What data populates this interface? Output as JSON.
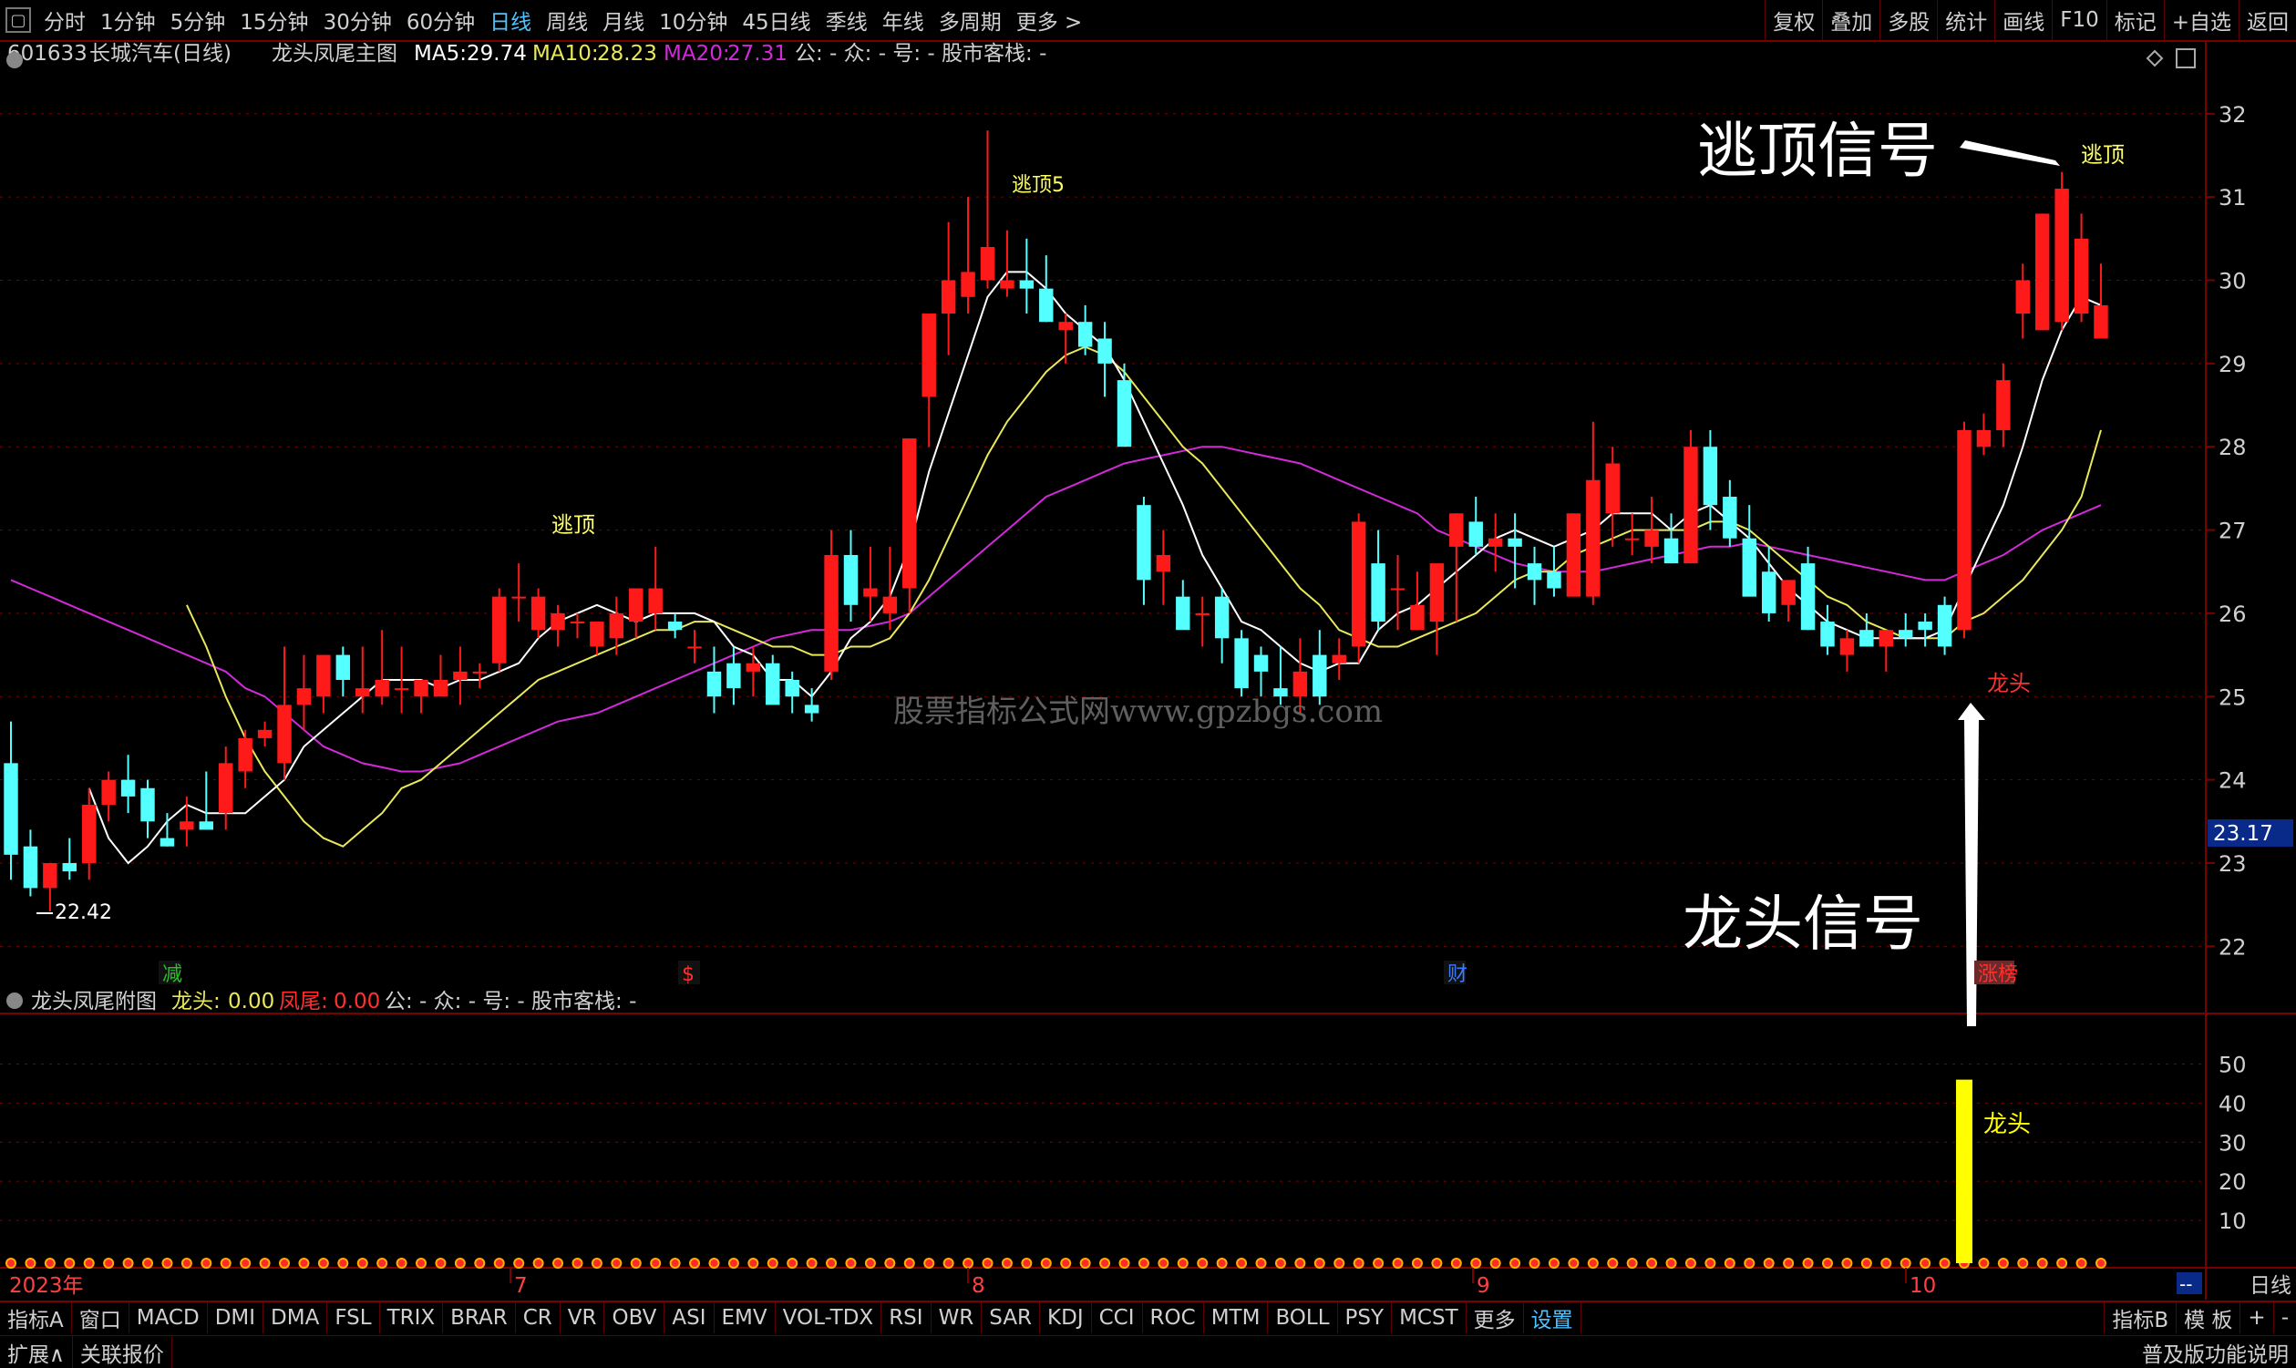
{
  "toolbar": {
    "icon": "window-menu-icon",
    "periods": [
      "分时",
      "1分钟",
      "5分钟",
      "15分钟",
      "30分钟",
      "60分钟",
      "日线",
      "周线",
      "月线",
      "10分钟",
      "45日线",
      "季线",
      "年线",
      "多周期",
      "更多 >"
    ],
    "active": "日线",
    "right": [
      "复权",
      "叠加",
      "多股",
      "统计",
      "画线",
      "F10",
      "标记",
      "+自选",
      "返回"
    ]
  },
  "main": {
    "code": "601633",
    "name": "长城汽车(日线)",
    "indicator": "龙头凤尾主图",
    "ma5_label": "MA5:",
    "ma5": "29.74",
    "ma10_label": "MA10:",
    "ma10": "28.23",
    "ma20_label": "MA20:",
    "ma20": "27.31",
    "extra": "公: -  众: -  号: -  股市客栈: -",
    "watermark": "股票指标公式网www.gpzbgs.com",
    "low_label": "22.42",
    "escape_label": "逃顶",
    "escape5_label": "逃顶5",
    "escape_right": "逃顶",
    "dragon_label": "龙头",
    "price_tag": "23.17",
    "markers": [
      "减",
      "$",
      "财",
      "涨榜"
    ]
  },
  "annotations": {
    "escape_signal": "逃顶信号",
    "dragon_signal": "龙头信号"
  },
  "sub": {
    "title": "龙头凤尾附图",
    "dragon_label": "龙头:",
    "dragon_val": "0.00",
    "tail_label": "凤尾:",
    "tail_val": "0.00",
    "extra": "公: -  众: -  号: -  股市客栈: -",
    "bar_label": "龙头"
  },
  "xaxis": {
    "year": "2023年",
    "months": [
      "7",
      "8",
      "9",
      "10"
    ]
  },
  "bottom": {
    "tabs": [
      "指标A",
      "窗口",
      "MACD",
      "DMI",
      "DMA",
      "FSL",
      "TRIX",
      "BRAR",
      "CR",
      "VR",
      "OBV",
      "ASI",
      "EMV",
      "VOL-TDX",
      "RSI",
      "WR",
      "SAR",
      "KDJ",
      "CCI",
      "ROC",
      "MTM",
      "BOLL",
      "PSY",
      "MCST",
      "更多",
      "设置"
    ],
    "right": [
      "指标B",
      "模 板",
      "+",
      "-"
    ],
    "expand": "扩展∧",
    "quote": "关联报价",
    "explain": "普及版功能说明",
    "period_label": "日线",
    "dash": "--"
  },
  "colors": {
    "up": "#ff1a1a",
    "down": "#54ffff",
    "ma5": "#ffffff",
    "ma10": "#e8e85a",
    "ma20": "#d22ad8",
    "grid": "#7a0000",
    "axis": "#d0d0d0",
    "bar": "#ffff00"
  },
  "chart_data": [
    {
      "type": "candlestick",
      "title": "601633 长城汽车(日线)",
      "yaxis_ticks": [
        32,
        31,
        30,
        29,
        28,
        27,
        26,
        25,
        24,
        23,
        22
      ],
      "ylim": [
        21.5,
        32.6
      ],
      "candles": [
        [
          24.2,
          24.7,
          22.8,
          23.1
        ],
        [
          23.2,
          23.4,
          22.6,
          22.7
        ],
        [
          22.7,
          23.0,
          22.42,
          23.0
        ],
        [
          23.0,
          23.3,
          22.8,
          22.9
        ],
        [
          23.0,
          23.9,
          22.8,
          23.7
        ],
        [
          23.7,
          24.1,
          23.5,
          24.0
        ],
        [
          24.0,
          24.3,
          23.6,
          23.8
        ],
        [
          23.9,
          24.0,
          23.3,
          23.5
        ],
        [
          23.3,
          23.6,
          23.2,
          23.2
        ],
        [
          23.4,
          23.8,
          23.2,
          23.5
        ],
        [
          23.5,
          24.1,
          23.4,
          23.4
        ],
        [
          23.6,
          24.4,
          23.4,
          24.2
        ],
        [
          24.1,
          24.6,
          23.9,
          24.5
        ],
        [
          24.5,
          24.7,
          24.4,
          24.6
        ],
        [
          24.2,
          25.6,
          24.0,
          24.9
        ],
        [
          24.9,
          25.5,
          24.6,
          25.1
        ],
        [
          25.0,
          25.5,
          24.8,
          25.5
        ],
        [
          25.5,
          25.6,
          25.0,
          25.2
        ],
        [
          25.0,
          25.6,
          24.8,
          25.1
        ],
        [
          25.0,
          25.8,
          24.9,
          25.2
        ],
        [
          25.1,
          25.6,
          24.8,
          25.1
        ],
        [
          25.0,
          25.2,
          24.8,
          25.2
        ],
        [
          25.0,
          25.5,
          25.0,
          25.2
        ],
        [
          25.2,
          25.6,
          24.9,
          25.3
        ],
        [
          25.3,
          25.4,
          25.1,
          25.3
        ],
        [
          25.4,
          26.3,
          25.3,
          26.2
        ],
        [
          26.2,
          26.6,
          25.9,
          26.2
        ],
        [
          25.8,
          26.3,
          25.7,
          26.2
        ],
        [
          25.8,
          26.1,
          25.6,
          26.0
        ],
        [
          25.9,
          26.0,
          25.7,
          25.9
        ],
        [
          25.6,
          25.9,
          25.5,
          25.9
        ],
        [
          25.7,
          26.2,
          25.5,
          26.0
        ],
        [
          25.9,
          26.2,
          25.7,
          26.3
        ],
        [
          26.0,
          26.8,
          25.8,
          26.3
        ],
        [
          25.9,
          26.0,
          25.7,
          25.8
        ],
        [
          25.6,
          25.8,
          25.4,
          25.6
        ],
        [
          25.3,
          25.6,
          24.8,
          25.0
        ],
        [
          25.4,
          25.6,
          24.9,
          25.1
        ],
        [
          25.3,
          25.6,
          25.0,
          25.4
        ],
        [
          25.4,
          25.5,
          24.9,
          24.9
        ],
        [
          25.2,
          25.3,
          24.8,
          25.0
        ],
        [
          24.9,
          25.1,
          24.7,
          24.8
        ],
        [
          25.3,
          27.0,
          25.2,
          26.7
        ],
        [
          26.7,
          27.0,
          25.9,
          26.1
        ],
        [
          26.2,
          26.8,
          25.9,
          26.3
        ],
        [
          26.0,
          26.8,
          25.8,
          26.2
        ],
        [
          26.3,
          28.1,
          26.0,
          28.1
        ],
        [
          28.6,
          29.1,
          28.0,
          29.6
        ],
        [
          29.6,
          30.7,
          29.1,
          30.0
        ],
        [
          29.8,
          31.0,
          29.6,
          30.1
        ],
        [
          30.0,
          31.8,
          29.9,
          30.4
        ],
        [
          29.9,
          30.6,
          29.8,
          30.0
        ],
        [
          30.0,
          30.5,
          29.6,
          29.9
        ],
        [
          29.9,
          30.3,
          29.5,
          29.5
        ],
        [
          29.4,
          29.6,
          29.0,
          29.5
        ],
        [
          29.5,
          29.7,
          29.1,
          29.2
        ],
        [
          29.3,
          29.5,
          28.6,
          29.0
        ],
        [
          28.8,
          29.0,
          28.4,
          28.0
        ],
        [
          27.3,
          27.4,
          26.1,
          26.4
        ],
        [
          26.5,
          27.0,
          26.1,
          26.7
        ],
        [
          26.2,
          26.4,
          25.9,
          25.8
        ],
        [
          26.0,
          26.2,
          25.6,
          26.0
        ],
        [
          26.2,
          26.3,
          25.4,
          25.7
        ],
        [
          25.7,
          25.8,
          25.0,
          25.1
        ],
        [
          25.5,
          25.6,
          25.0,
          25.3
        ],
        [
          25.1,
          25.6,
          24.9,
          25.0
        ],
        [
          25.0,
          25.7,
          24.8,
          25.3
        ],
        [
          25.5,
          25.8,
          24.9,
          25.0
        ],
        [
          25.4,
          25.7,
          25.2,
          25.5
        ],
        [
          25.6,
          27.2,
          25.4,
          27.1
        ],
        [
          26.6,
          27.0,
          25.8,
          25.9
        ],
        [
          26.3,
          26.7,
          25.8,
          26.3
        ],
        [
          25.8,
          26.5,
          25.8,
          26.1
        ],
        [
          25.9,
          26.5,
          25.5,
          26.6
        ],
        [
          26.8,
          27.2,
          25.9,
          27.2
        ],
        [
          27.1,
          27.4,
          26.7,
          26.8
        ],
        [
          26.8,
          27.2,
          26.5,
          26.9
        ],
        [
          26.9,
          27.2,
          26.3,
          26.8
        ],
        [
          26.6,
          26.8,
          26.1,
          26.4
        ],
        [
          26.5,
          26.8,
          26.2,
          26.3
        ],
        [
          26.2,
          27.2,
          26.2,
          27.2
        ],
        [
          26.2,
          28.3,
          26.1,
          27.6
        ],
        [
          27.2,
          28.0,
          26.8,
          27.8
        ],
        [
          26.9,
          27.2,
          26.7,
          26.9
        ],
        [
          26.8,
          27.4,
          26.6,
          27.0
        ],
        [
          26.9,
          27.2,
          26.6,
          26.6
        ],
        [
          26.6,
          28.2,
          26.6,
          28.0
        ],
        [
          28.0,
          28.2,
          27.0,
          27.3
        ],
        [
          27.4,
          27.6,
          26.8,
          26.9
        ],
        [
          26.9,
          27.3,
          26.3,
          26.2
        ],
        [
          26.5,
          26.8,
          25.9,
          26.0
        ],
        [
          26.1,
          26.4,
          25.9,
          26.4
        ],
        [
          26.6,
          26.8,
          25.8,
          25.8
        ],
        [
          25.9,
          26.1,
          25.5,
          25.6
        ],
        [
          25.5,
          25.8,
          25.3,
          25.7
        ],
        [
          25.8,
          26.0,
          25.6,
          25.6
        ],
        [
          25.6,
          25.8,
          25.3,
          25.8
        ],
        [
          25.8,
          26.0,
          25.6,
          25.7
        ],
        [
          25.9,
          26.0,
          25.6,
          25.8
        ],
        [
          26.1,
          26.2,
          25.5,
          25.6
        ],
        [
          25.8,
          28.3,
          25.7,
          28.2
        ],
        [
          28.0,
          28.4,
          27.9,
          28.2
        ],
        [
          28.2,
          29.0,
          28.0,
          28.8
        ],
        [
          29.6,
          30.2,
          29.3,
          30.0
        ],
        [
          29.4,
          30.8,
          29.4,
          30.8
        ],
        [
          29.5,
          31.3,
          29.4,
          31.1
        ],
        [
          29.6,
          30.8,
          29.5,
          30.5
        ],
        [
          29.3,
          30.2,
          29.3,
          29.7
        ]
      ],
      "ma5": [
        null,
        null,
        null,
        null,
        23.9,
        23.3,
        23.0,
        23.2,
        23.5,
        23.7,
        23.6,
        23.6,
        23.6,
        23.8,
        24.0,
        24.4,
        24.6,
        24.8,
        25.0,
        25.2,
        25.2,
        25.2,
        25.1,
        25.2,
        25.2,
        25.3,
        25.4,
        25.7,
        25.9,
        26.0,
        26.1,
        26.0,
        25.9,
        26.0,
        26.0,
        26.0,
        25.9,
        25.6,
        25.5,
        25.2,
        25.2,
        25.0,
        25.3,
        25.7,
        25.9,
        26.2,
        26.8,
        27.7,
        28.4,
        29.1,
        29.8,
        30.1,
        30.1,
        29.9,
        29.6,
        29.4,
        29.2,
        28.8,
        28.3,
        27.8,
        27.3,
        26.7,
        26.3,
        25.9,
        25.8,
        25.6,
        25.4,
        25.3,
        25.4,
        25.4,
        25.8,
        26.0,
        26.1,
        26.3,
        26.5,
        26.7,
        26.9,
        27.0,
        26.9,
        26.8,
        26.9,
        27.0,
        27.2,
        27.2,
        27.2,
        27.0,
        27.2,
        27.3,
        27.1,
        26.9,
        26.6,
        26.3,
        26.1,
        25.9,
        25.8,
        25.7,
        25.7,
        25.7,
        25.7,
        25.8,
        26.3,
        26.8,
        27.3,
        28.0,
        28.8,
        29.4,
        29.8,
        29.7
      ],
      "ma10": [
        null,
        null,
        null,
        null,
        null,
        null,
        null,
        null,
        null,
        26.1,
        25.6,
        25.0,
        24.5,
        24.1,
        23.8,
        23.5,
        23.3,
        23.2,
        23.4,
        23.6,
        23.9,
        24.0,
        24.2,
        24.4,
        24.6,
        24.8,
        25.0,
        25.2,
        25.3,
        25.4,
        25.5,
        25.6,
        25.7,
        25.8,
        25.8,
        25.9,
        25.9,
        25.8,
        25.7,
        25.6,
        25.6,
        25.5,
        25.5,
        25.6,
        25.6,
        25.7,
        26.0,
        26.4,
        26.9,
        27.4,
        27.9,
        28.3,
        28.6,
        28.9,
        29.1,
        29.2,
        29.1,
        28.9,
        28.6,
        28.3,
        28.0,
        27.8,
        27.5,
        27.2,
        26.9,
        26.6,
        26.3,
        26.1,
        25.8,
        25.7,
        25.6,
        25.6,
        25.7,
        25.8,
        25.9,
        26.0,
        26.2,
        26.4,
        26.5,
        26.5,
        26.7,
        26.8,
        26.9,
        27.0,
        27.0,
        27.0,
        27.0,
        27.1,
        27.1,
        27.0,
        26.8,
        26.6,
        26.4,
        26.2,
        26.1,
        25.9,
        25.8,
        25.7,
        25.7,
        25.7,
        25.9,
        26.0,
        26.2,
        26.4,
        26.7,
        27.0,
        27.4,
        28.2
      ],
      "ma20": [
        26.4,
        26.3,
        26.2,
        26.1,
        26.0,
        25.9,
        25.8,
        25.7,
        25.6,
        25.5,
        25.4,
        25.3,
        25.1,
        25.0,
        24.8,
        24.6,
        24.4,
        24.3,
        24.2,
        24.15,
        24.1,
        24.1,
        24.15,
        24.2,
        24.3,
        24.4,
        24.5,
        24.6,
        24.7,
        24.75,
        24.8,
        24.9,
        25.0,
        25.1,
        25.2,
        25.3,
        25.4,
        25.5,
        25.6,
        25.7,
        25.75,
        25.8,
        25.8,
        25.8,
        25.85,
        25.9,
        26.0,
        26.2,
        26.4,
        26.6,
        26.8,
        27.0,
        27.2,
        27.4,
        27.5,
        27.6,
        27.7,
        27.8,
        27.85,
        27.9,
        27.95,
        28.0,
        28.0,
        27.95,
        27.9,
        27.85,
        27.8,
        27.7,
        27.6,
        27.5,
        27.4,
        27.3,
        27.2,
        27.0,
        26.9,
        26.8,
        26.7,
        26.6,
        26.55,
        26.5,
        26.5,
        26.5,
        26.55,
        26.6,
        26.65,
        26.7,
        26.75,
        26.8,
        26.8,
        26.85,
        26.8,
        26.75,
        26.7,
        26.65,
        26.6,
        26.55,
        26.5,
        26.45,
        26.4,
        26.4,
        26.5,
        26.6,
        26.7,
        26.85,
        27.0,
        27.1,
        27.2,
        27.3
      ]
    },
    {
      "type": "bar",
      "title": "龙头凤尾附图",
      "yaxis_ticks": [
        50,
        40,
        30,
        20,
        10
      ],
      "ylim": [
        0,
        55
      ],
      "series": [
        {
          "name": "龙头",
          "values": {
            "index": 100,
            "value": 46
          }
        }
      ]
    }
  ]
}
